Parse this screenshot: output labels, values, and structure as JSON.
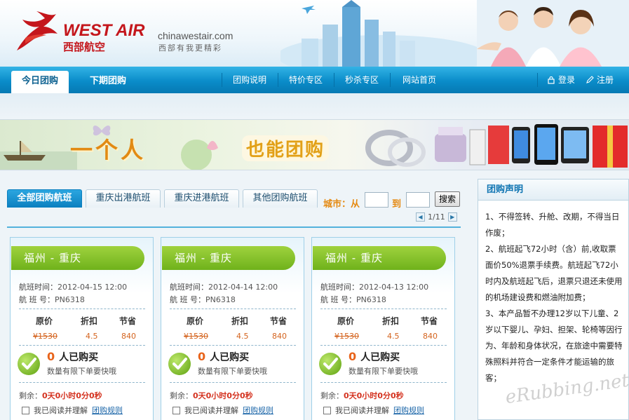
{
  "header": {
    "brand": "WEST AIR",
    "brand_cn": "西部航空",
    "domain": "chinawestair.com",
    "slogan": "西部有我更精彩"
  },
  "nav": {
    "tabs": [
      "今日团购",
      "下期团购"
    ],
    "links": [
      "团购说明",
      "特价专区",
      "秒杀专区",
      "网站首页"
    ],
    "login": "登录",
    "register": "注册"
  },
  "banner": {
    "text1": "一个人",
    "text2": "也能团购"
  },
  "filter": {
    "tabs": [
      "全部团购航班",
      "重庆出港航班",
      "重庆进港航班",
      "其他团购航班"
    ],
    "city_from_label": "城市：从",
    "city_to_label": "到",
    "search_label": "搜索",
    "from_value": "",
    "to_value": "",
    "page": "1/11"
  },
  "card_labels": {
    "time_label": "航班时间：",
    "flight_label": "航 班 号：",
    "price_headers": [
      "原价",
      "折扣",
      "节省"
    ],
    "buy_suffix": "人已购买",
    "note": "数量有限下单要快哦",
    "remain_label": "剩余：",
    "remain_value": "0天0小时0分0秒",
    "agree_text": "我已阅读并理解",
    "rules_link": "团购规则"
  },
  "flights": [
    {
      "route": "福州 - 重庆",
      "time": "2012-04-15 12:00",
      "flight_no": "PN6318",
      "original": "¥1530",
      "discount": "4.5",
      "save": "840",
      "bought": "0"
    },
    {
      "route": "福州 - 重庆",
      "time": "2012-04-14 12:00",
      "flight_no": "PN6318",
      "original": "¥1530",
      "discount": "4.5",
      "save": "840",
      "bought": "0"
    },
    {
      "route": "福州 - 重庆",
      "time": "2012-04-13 12:00",
      "flight_no": "PN6318",
      "original": "¥1530",
      "discount": "4.5",
      "save": "840",
      "bought": "0"
    }
  ],
  "side": {
    "title": "团购声明",
    "items": [
      "1、不得签转、升舱、改期，不得当日作废；",
      "2、航班起飞72小时（含）前,收取票面价50%退票手续费。航班起飞72小时内及航班起飞后，退票只退还未使用的机场建设费和燃油附加费；",
      "3、本产品暂不办理12岁以下儿童、2岁以下婴儿、孕妇、担架、轮椅等因行为、年龄和身体状况，在旅途中需要特殊照料并符合一定条件才能运输的旅客；"
    ]
  },
  "watermark": "eRubbing.net",
  "colors": {
    "brand_red": "#c4161c",
    "nav_blue": "#0a8cc9",
    "card_green": "#6fb21b",
    "accent_orange": "#e58a12"
  }
}
